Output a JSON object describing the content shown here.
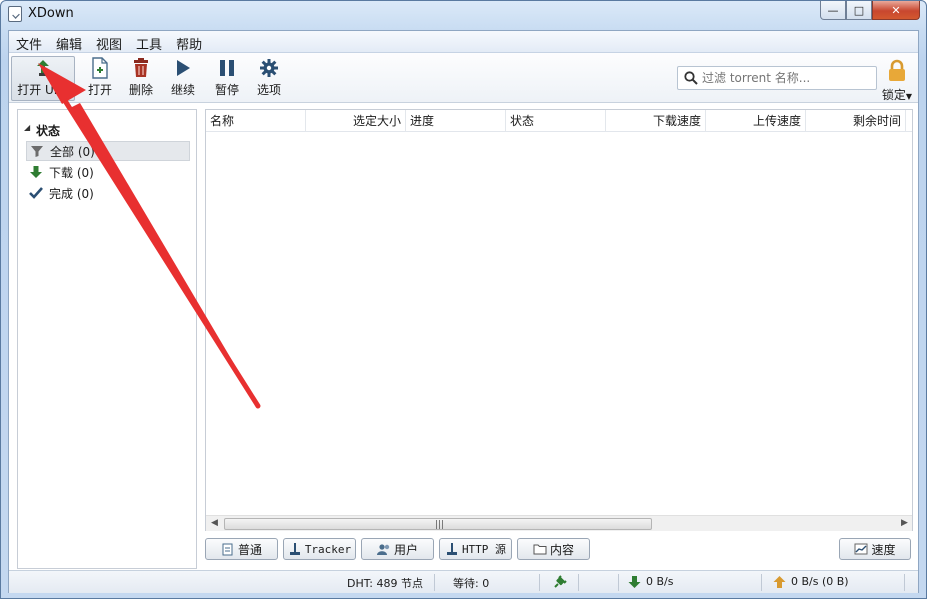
{
  "window": {
    "title": "XDown",
    "controls": {
      "minimize": "—",
      "maximize": "□",
      "close": "✕"
    }
  },
  "menu": [
    "文件",
    "编辑",
    "视图",
    "工具",
    "帮助"
  ],
  "toolbar": {
    "open_url": "打开 URL",
    "open": "打开",
    "delete": "删除",
    "resume": "继续",
    "pause": "暂停",
    "options": "选项",
    "search_placeholder": "过滤 torrent 名称...",
    "lock": "锁定"
  },
  "sidebar": {
    "header": "状态",
    "items": [
      {
        "label": "全部 (0)",
        "icon": "funnel-icon"
      },
      {
        "label": "下载 (0)",
        "icon": "arrow-down-icon"
      },
      {
        "label": "完成 (0)",
        "icon": "check-icon"
      }
    ]
  },
  "table": {
    "columns": [
      "名称",
      "选定大小",
      "进度",
      "状态",
      "下载速度",
      "上传速度",
      "剩余时间"
    ],
    "rows": []
  },
  "tabs": [
    "普通",
    "Tracker",
    "用户",
    "HTTP 源",
    "内容",
    "速度"
  ],
  "statusbar": {
    "dht": "DHT: 489 节点",
    "waiting": "等待: 0",
    "down_speed": "0 B/s",
    "up_speed": "0 B/s (0 B)"
  },
  "colors": {
    "accent_green": "#2f7d32",
    "lock_orange": "#e0a030",
    "annotation_red": "#e83030"
  }
}
